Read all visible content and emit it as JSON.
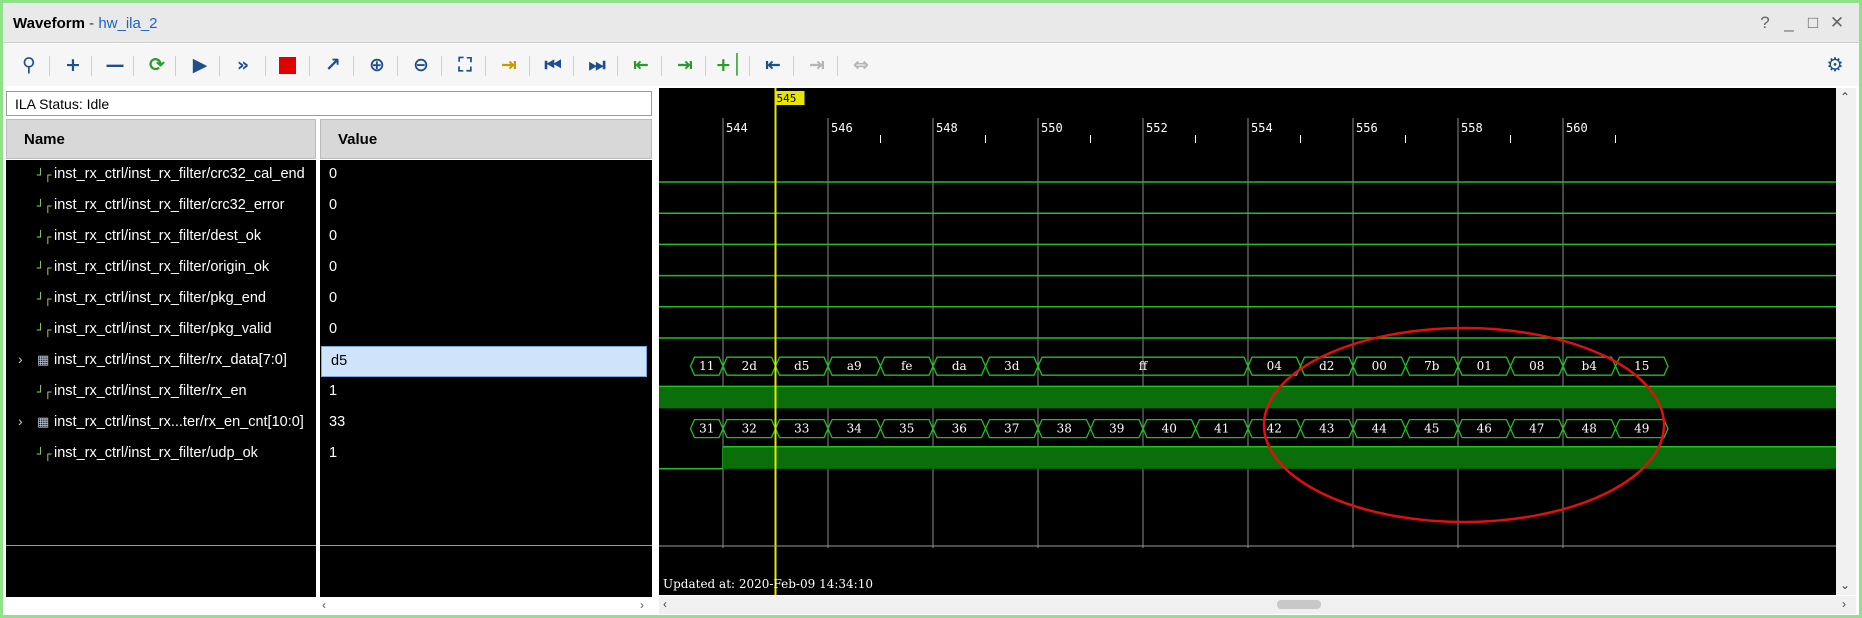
{
  "window": {
    "title_bold": "Waveform",
    "title_sep": " - ",
    "title_link": "hw_ila_2",
    "help": "?",
    "minimize": "_",
    "maximize": "□",
    "close": "✕"
  },
  "toolbar": {
    "icons": [
      "search-icon",
      "zoom-add-icon",
      "remove-icon",
      "run-trigger-icon",
      "run-icon",
      "run-immediate-icon",
      "stop-icon",
      "export-icon",
      "zoom-in-icon",
      "zoom-out-icon",
      "zoom-fit-icon",
      "go-to-cursor-icon",
      "go-to-time-zero-icon",
      "go-to-last-time-icon",
      "previous-transition-icon",
      "next-transition-icon",
      "add-marker-icon",
      "previous-marker-icon",
      "next-marker-icon",
      "swap-cursors-icon",
      "settings-icon"
    ]
  },
  "ila_status": "ILA Status: Idle",
  "columns": {
    "name": "Name",
    "value": "Value"
  },
  "signals": [
    {
      "name": "inst_rx_ctrl/inst_rx_filter/crc32_cal_end",
      "value": "0",
      "type": "bit"
    },
    {
      "name": "inst_rx_ctrl/inst_rx_filter/crc32_error",
      "value": "0",
      "type": "bit"
    },
    {
      "name": "inst_rx_ctrl/inst_rx_filter/dest_ok",
      "value": "0",
      "type": "bit"
    },
    {
      "name": "inst_rx_ctrl/inst_rx_filter/origin_ok",
      "value": "0",
      "type": "bit"
    },
    {
      "name": "inst_rx_ctrl/inst_rx_filter/pkg_end",
      "value": "0",
      "type": "bit"
    },
    {
      "name": "inst_rx_ctrl/inst_rx_filter/pkg_valid",
      "value": "0",
      "type": "bit"
    },
    {
      "name": "inst_rx_ctrl/inst_rx_filter/rx_data[7:0]",
      "value": "d5",
      "type": "bus",
      "selected": true
    },
    {
      "name": "inst_rx_ctrl/inst_rx_filter/rx_en",
      "value": "1",
      "type": "bit"
    },
    {
      "name": "inst_rx_ctrl/inst_rx...ter/rx_en_cnt[10:0]",
      "value": "33",
      "type": "bus"
    },
    {
      "name": "inst_rx_ctrl/inst_rx_filter/udp_ok",
      "value": "1",
      "type": "bit"
    }
  ],
  "waveform": {
    "cursor_label": "545",
    "time_ticks": [
      "544",
      "546",
      "548",
      "550",
      "552",
      "554",
      "556",
      "558",
      "560"
    ],
    "rx_data_values": [
      "11",
      "2d",
      "d5",
      "a9",
      "fe",
      "da",
      "3d",
      "ff",
      "04",
      "d2",
      "00",
      "7b",
      "01",
      "08",
      "b4",
      "15"
    ],
    "rx_en_cnt_values": [
      "31",
      "32",
      "33",
      "34",
      "35",
      "36",
      "37",
      "38",
      "39",
      "40",
      "41",
      "42",
      "43",
      "44",
      "45",
      "46",
      "47",
      "48",
      "49"
    ],
    "updated_at": "Updated at: 2020-Feb-09 14:34:10",
    "annotation_color": "#e01010",
    "wave_color": "#1fbf1f",
    "cursor_color": "#e6e600"
  }
}
